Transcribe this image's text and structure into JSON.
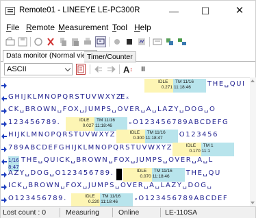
{
  "window": {
    "title": "Remote01 - LINEEYE LE-PC300R",
    "minimize": "—",
    "maximize": "☐",
    "close": "✕"
  },
  "menu": [
    "File",
    "Remote",
    "Measurement",
    "Tool",
    "Help"
  ],
  "toolbar_icons": [
    "open-icon",
    "save-icon",
    "record-icon",
    "trigger-icon",
    "copy-icon",
    "paste-icon",
    "print-icon",
    "monitor-icon",
    "start-icon",
    "stop-icon",
    "display-icon",
    "settings-icon",
    "config-icon",
    "layout-icon"
  ],
  "tabs": {
    "monitor": "Data monitor (Normal view)",
    "timer": "Timer/Counter"
  },
  "display": {
    "mode": "ASCII",
    "font_size_label": "A",
    "pause_label": "II"
  },
  "data_lines": [
    {
      "dir": "rx",
      "pre": "",
      "text": "THE␣QUI",
      "ts": {
        "idle": "IDLE",
        "idle_val": "0.271",
        "tm_label": "TM 11/16",
        "tm_val": "11:18:46"
      }
    },
    {
      "dir": "tx",
      "text": "GHIJKLMNOPQRSTUVWXYZ",
      "tail": "Eₓ"
    },
    {
      "dir": "rx",
      "text": "CK␣BROWN␣FOX␣JUMPS␣OVER␣A␣LAZY␣DOG␣O"
    },
    {
      "dir": "rx",
      "text": "123456789.",
      "ts": {
        "idle": "IDLE",
        "idle_val": "0.027",
        "tm_label": "TM 11/16",
        "tm_val": "11:18:46"
      },
      "after": "ₓO123456789ABCDEFG"
    },
    {
      "dir": "tx",
      "text": "HIJKLMNOPQRSTUVWXYZ",
      "ts": {
        "idle": "IDLE",
        "idle_val": "0.300",
        "tm_label": "TM 11/16",
        "tm_val": "11:18:47"
      },
      "after": "O123456"
    },
    {
      "dir": "rx",
      "text": "789ABCDEFGHIJKLMNOPQRSTUVWXYZ",
      "ts": {
        "idle": "IDLE",
        "idle_val": "0.170",
        "tm_label": "TM 1",
        "tm_val": "11:1"
      }
    },
    {
      "dir": "tx",
      "lead": "1/16",
      "text": "THE␣QUICK␣BROWN␣FOX␣JUMPS␣OVER␣A␣L",
      "sub": "8:47"
    },
    {
      "dir": "rx",
      "text": "AZY␣DOG␣O123456789.",
      "ts": {
        "idle": "IDLE",
        "idle_val": "0.070",
        "tm_label": "TM 11/16",
        "tm_val": "11:18:46"
      },
      "after": "THE␣QU"
    },
    {
      "dir": "rx",
      "text": "ICK␣BROWN␣FOX␣JUMPS␣OVER␣A␣LAZY␣DOG␣"
    },
    {
      "dir": "rx",
      "text": "O123456789.",
      "ts": {
        "idle": "IDLE",
        "idle_val": "0.220",
        "tm_label": "TM 11/16",
        "tm_val": "11:18:46"
      },
      "after": "ₓO123456789ABCDEF"
    }
  ],
  "status": {
    "lost": "Lost count : 0",
    "state": "Measuring",
    "connection": "Online",
    "model": "LE-110SA"
  },
  "colors": {
    "rx_arrow": "#1f3fbf",
    "tx_arrow": "#1f3fbf",
    "idle_bg": "#fdf5b4",
    "tm_bg": "#b8e4ec",
    "data_text": "#1f1f8f"
  }
}
